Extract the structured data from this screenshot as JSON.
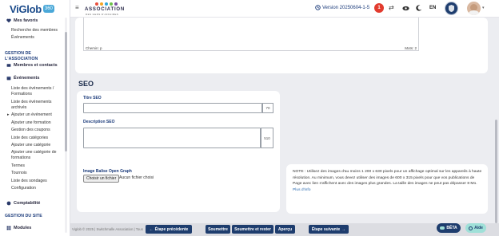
{
  "sidebar": {
    "logo_text": "ViGlob",
    "logo_badge": "360",
    "favorites_label": "Mes favoris",
    "favorites_items": [
      "Recherche des membres",
      "Événements"
    ],
    "section_association": "GESTION DE L'ASSOCIATION",
    "members_label": "Membres et contacts",
    "events_label": "Événements",
    "events_items": [
      "Liste des événements / Formations",
      "Liste des événements archivés",
      "Ajouter un événement",
      "Ajouter une formation",
      "Gestion des coupons",
      "Liste des catégories",
      "Ajouter une catégorie",
      "Ajouter une catégorie de formations",
      "Termes",
      "Tournois",
      "Liste des sondages",
      "Configuration"
    ],
    "comptabilite_label": "Comptabilité",
    "section_site": "GESTION DU SITE",
    "modules_label": "Modules"
  },
  "topbar": {
    "assoc_name": "ASSOCIATION",
    "assoc_sub": "DES GENS D'AFFAIRES",
    "version": "Version 20250604-1-5",
    "notif_count": "1",
    "language": "EN"
  },
  "editor": {
    "path_label": "Chemin: p",
    "word_count": "Mots: 2"
  },
  "seo": {
    "heading": "SEO",
    "title_label": "Titre SEO",
    "title_counter": "70",
    "desc_label": "Description SEO",
    "desc_counter": "510",
    "og_label": "Image Balise Open Graph",
    "file_button": "Choisir un fichier",
    "file_status": "Aucun fichier choisi",
    "note_text": "NOTE : Utilisez des images d'au moins 1 200 x 630 pixels pour un affichage optimal sur les appareils à haute résolution. Au minimum, vous devez utiliser des images de 600 x 315 pixels pour que vos publications de Page avec lien s'affichent avec des images plus grandes. La taille des images ne peut pas dépasser 8 Mo.",
    "note_link": "Plus d'info"
  },
  "footer": {
    "copyright": "Viglob © 2025 | Switchmalle Association | Tous",
    "prev_step": "Étape précédente",
    "submit": "Soumettre",
    "submit_stay": "Soumettre et rester",
    "preview": "Aperçu",
    "next_step": "Étape suivante",
    "beta": "BÊTA",
    "help": "Aide"
  },
  "colors": {
    "primary": "#1e3d6e",
    "accent_teal": "#9fe0d8",
    "notif": "#e23b2e"
  }
}
